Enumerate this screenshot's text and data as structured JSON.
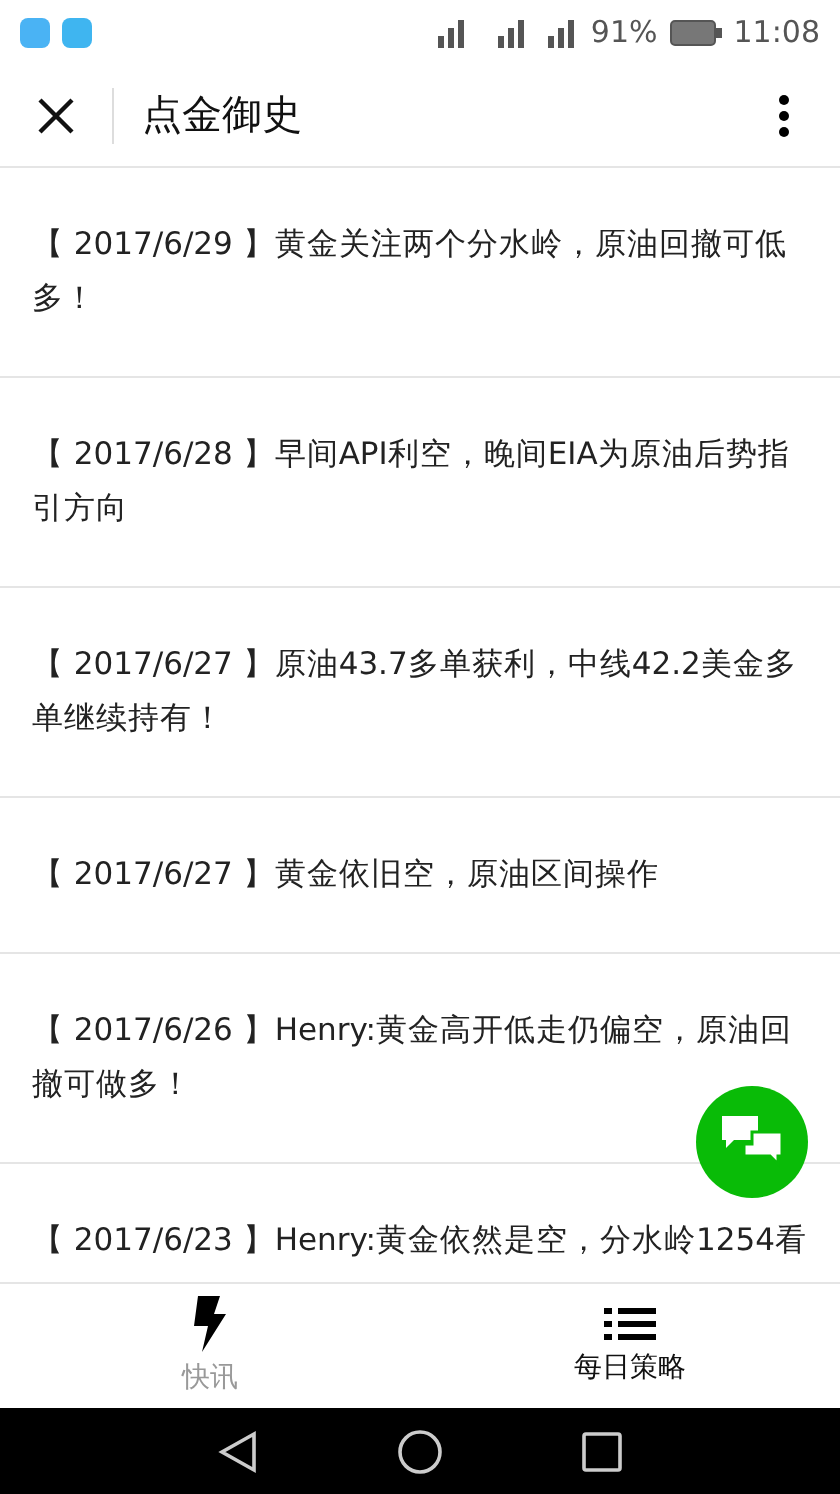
{
  "status_bar": {
    "battery": "91%",
    "time": "11:08"
  },
  "header": {
    "title": "点金御史"
  },
  "articles": [
    {
      "title": "【 2017/6/29 】黄金关注两个分水岭，原油回撤可低多！"
    },
    {
      "title": "【 2017/6/28 】早间API利空，晚间EIA为原油后势指引方向"
    },
    {
      "title": "【 2017/6/27 】原油43.7多单获利，中线42.2美金多单继续持有！"
    },
    {
      "title": "【 2017/6/27 】黄金依旧空，原油区间操作"
    },
    {
      "title": "【 2017/6/26 】Henry:黄金高开低走仍偏空，原油回撤可做多！"
    },
    {
      "title": "【 2017/6/23 】Henry:黄金依然是空，分水岭1254看"
    }
  ],
  "tabs": [
    {
      "label": "快讯",
      "kind": "flash",
      "selected": false
    },
    {
      "label": "每日策略",
      "kind": "list",
      "selected": true
    }
  ]
}
